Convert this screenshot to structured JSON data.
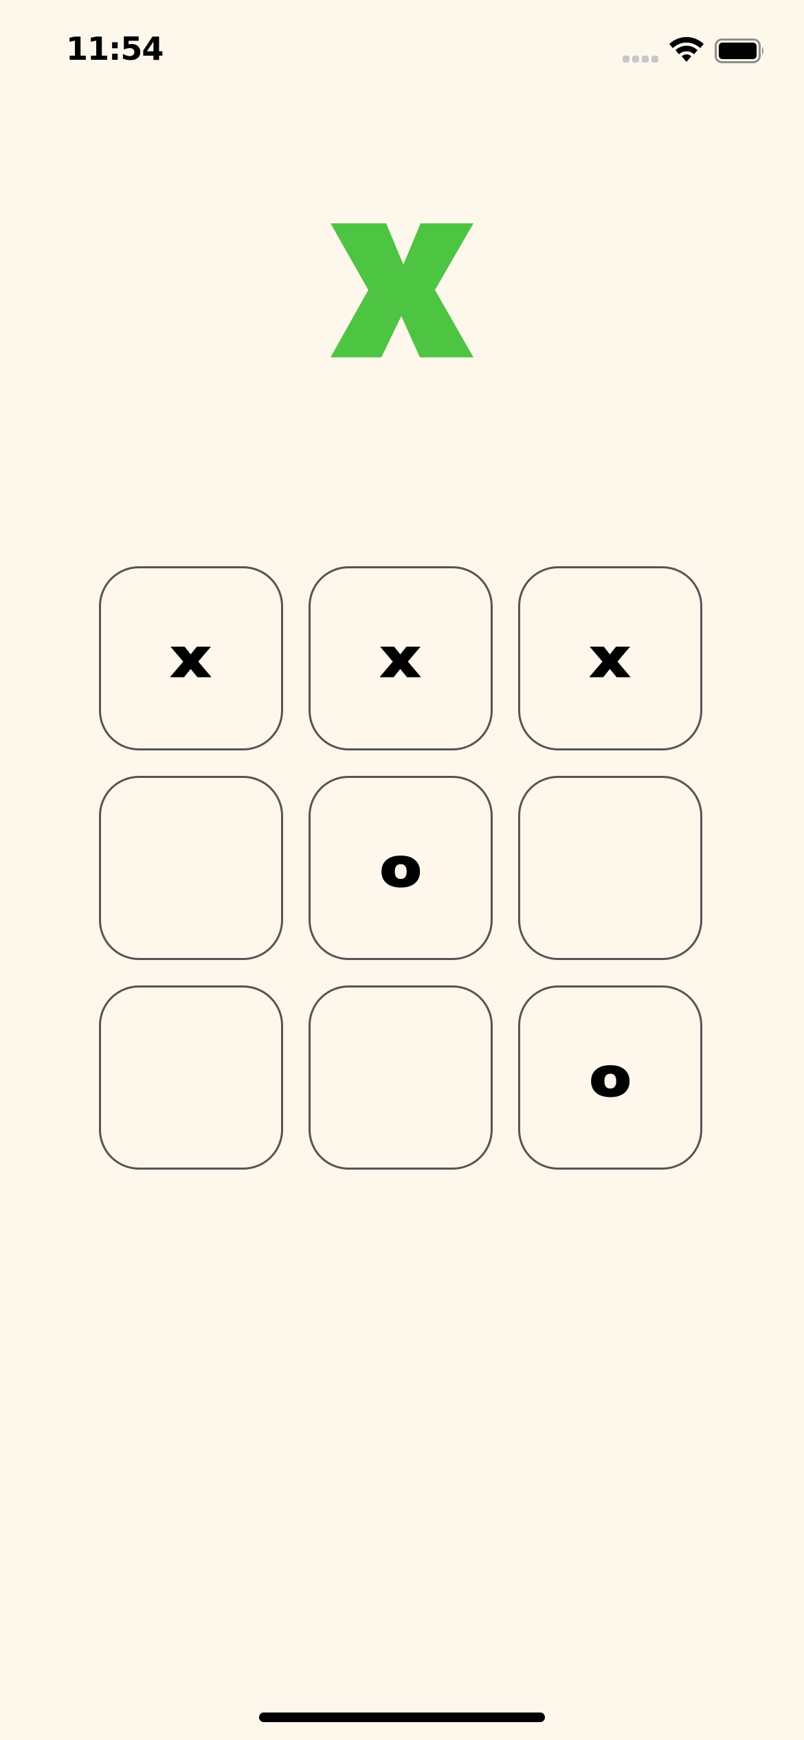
{
  "status_bar": {
    "time": "11:54",
    "signal_icon": "cellular-signal-icon",
    "wifi_icon": "wifi-icon",
    "battery_icon": "battery-icon"
  },
  "game": {
    "current_winner": "X",
    "winner_color": "#4ec443",
    "board": [
      "x",
      "x",
      "x",
      "",
      "o",
      "",
      "",
      "",
      "o"
    ]
  }
}
